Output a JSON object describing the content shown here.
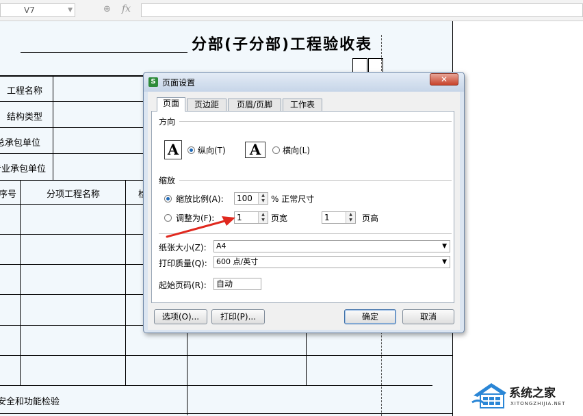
{
  "formula_bar": {
    "cell_ref": "V7",
    "fx_label": "fx"
  },
  "sheet": {
    "title": "分部(子分部)工程验收表",
    "row_labels": [
      "工程名称",
      "结构类型",
      "总承包单位",
      "专业承包单位"
    ],
    "table_headers": {
      "seq": "序号",
      "item_name": "分项工程名称",
      "partial": "检"
    },
    "footer_label": "安全和功能检验"
  },
  "dialog": {
    "title": "页面设置",
    "close_symbol": "✕",
    "tabs": [
      "页面",
      "页边距",
      "页眉/页脚",
      "工作表"
    ],
    "active_tab": "页面",
    "orientation": {
      "section_label": "方向",
      "icon_letter": "A",
      "portrait_label": "纵向(T)",
      "landscape_label": "横向(L)",
      "selected": "portrait"
    },
    "scaling": {
      "section_label": "缩放",
      "scale_label": "缩放比例(A):",
      "scale_value": "100",
      "scale_unit": "% 正常尺寸",
      "fit_label": "调整为(F):",
      "pages_wide_value": "1",
      "pages_wide_label": "页宽",
      "pages_tall_value": "1",
      "pages_tall_label": "页高",
      "selected": "scale"
    },
    "paper_size": {
      "label": "纸张大小(Z):",
      "value": "A4"
    },
    "print_quality": {
      "label": "打印质量(Q):",
      "value": "600 点/英寸"
    },
    "first_page": {
      "label": "起始页码(R):",
      "value": "自动"
    },
    "buttons": {
      "options": "选项(O)...",
      "print": "打印(P)...",
      "ok": "确定",
      "cancel": "取消"
    }
  },
  "watermark": {
    "name": "系统之家",
    "domain": "XITONGZHIJIA.NET"
  },
  "colors": {
    "print_area": "#f2f8fc",
    "dialog_frame": "#dbe5f1",
    "arrow": "#e0281e",
    "app_icon": "#2e8b3a"
  }
}
